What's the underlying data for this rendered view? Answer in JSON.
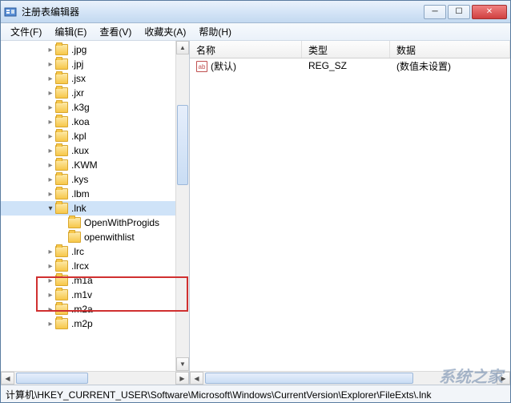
{
  "window": {
    "title": "注册表编辑器"
  },
  "menu": {
    "file": "文件(F)",
    "edit": "编辑(E)",
    "view": "查看(V)",
    "favorites": "收藏夹(A)",
    "help": "帮助(H)"
  },
  "tree": {
    "items": [
      {
        "label": ".jpg",
        "depth": 3,
        "expanded": false
      },
      {
        "label": ".jpj",
        "depth": 3,
        "expanded": false
      },
      {
        "label": ".jsx",
        "depth": 3,
        "expanded": false
      },
      {
        "label": ".jxr",
        "depth": 3,
        "expanded": false
      },
      {
        "label": ".k3g",
        "depth": 3,
        "expanded": false
      },
      {
        "label": ".koa",
        "depth": 3,
        "expanded": false
      },
      {
        "label": ".kpl",
        "depth": 3,
        "expanded": false
      },
      {
        "label": ".kux",
        "depth": 3,
        "expanded": false
      },
      {
        "label": ".KWM",
        "depth": 3,
        "expanded": false
      },
      {
        "label": ".kys",
        "depth": 3,
        "expanded": false
      },
      {
        "label": ".lbm",
        "depth": 3,
        "expanded": false
      },
      {
        "label": ".lnk",
        "depth": 3,
        "expanded": true,
        "selected": true
      },
      {
        "label": "OpenWithProgids",
        "depth": 4,
        "expanded": null,
        "highlight": true
      },
      {
        "label": "openwithlist",
        "depth": 4,
        "expanded": null,
        "highlight": true
      },
      {
        "label": ".lrc",
        "depth": 3,
        "expanded": false
      },
      {
        "label": ".lrcx",
        "depth": 3,
        "expanded": false
      },
      {
        "label": ".m1a",
        "depth": 3,
        "expanded": false
      },
      {
        "label": ".m1v",
        "depth": 3,
        "expanded": false
      },
      {
        "label": ".m2a",
        "depth": 3,
        "expanded": false
      },
      {
        "label": ".m2p",
        "depth": 3,
        "expanded": false
      }
    ]
  },
  "list": {
    "headers": {
      "name": "名称",
      "type": "类型",
      "data": "数据"
    },
    "rows": [
      {
        "icon": "ab",
        "name": "(默认)",
        "type": "REG_SZ",
        "data": "(数值未设置)"
      }
    ]
  },
  "statusbar": {
    "path": "计算机\\HKEY_CURRENT_USER\\Software\\Microsoft\\Windows\\CurrentVersion\\Explorer\\FileExts\\.lnk"
  },
  "watermark": "系统之家"
}
